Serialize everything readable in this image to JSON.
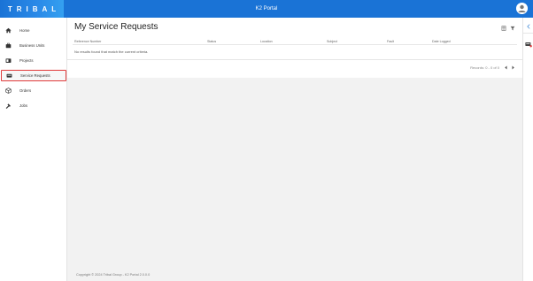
{
  "header": {
    "logo_text": "TRIBAL",
    "app_title": "K2 Portal"
  },
  "sidebar": {
    "items": [
      {
        "label": "Home",
        "icon": "home-icon"
      },
      {
        "label": "Business Units",
        "icon": "briefcase-icon"
      },
      {
        "label": "Projects",
        "icon": "projects-icon"
      },
      {
        "label": "Service Requests",
        "icon": "service-requests-icon",
        "active": true
      },
      {
        "label": "Orders",
        "icon": "orders-icon"
      },
      {
        "label": "Jobs",
        "icon": "jobs-icon"
      }
    ]
  },
  "main": {
    "title": "My Service Requests",
    "columns": [
      "Reference Number",
      "Status",
      "Location",
      "Subject",
      "Fault",
      "Date Logged"
    ],
    "empty_message": "No results found that match the current criteria.",
    "pager_text": "Records: 0 - 0 of 0"
  },
  "footer": {
    "text": "Copyright © 2024 Tribal Group - K2 Portal 2.0.0.0"
  },
  "colors": {
    "header": "#1a73d6",
    "active_outline": "#e03a3a"
  }
}
